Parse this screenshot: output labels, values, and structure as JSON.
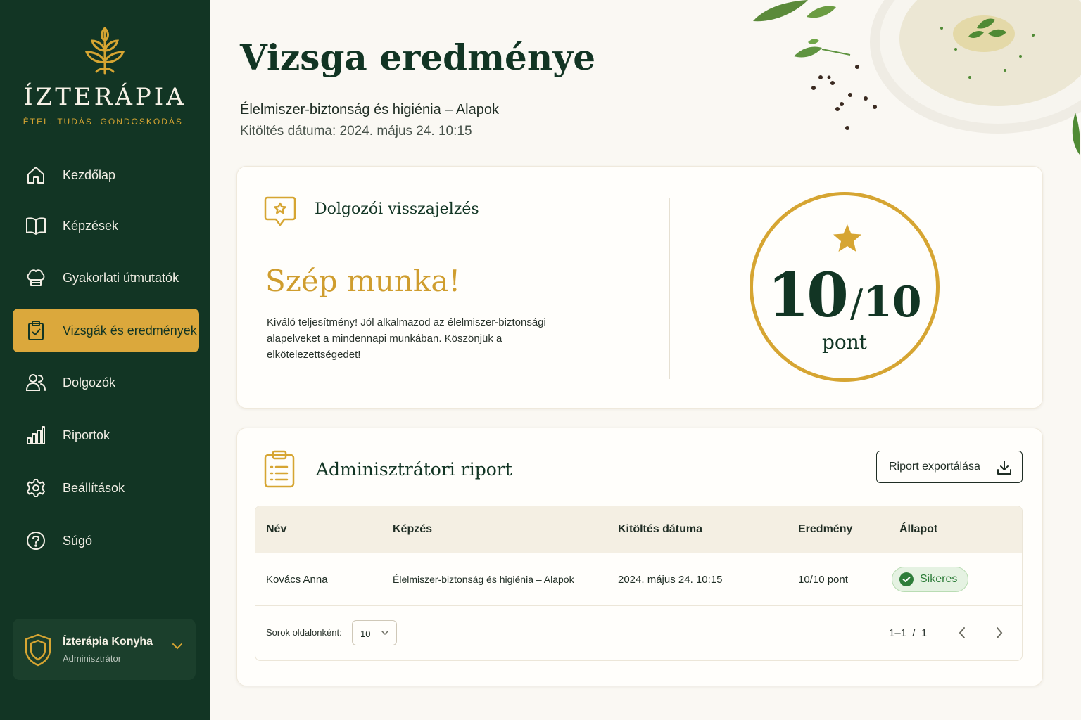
{
  "brand": {
    "name": "ÍZTERÁPIA",
    "tagline": "ÉTEL. TUDÁS. GONDOSKODÁS."
  },
  "nav": [
    {
      "label": "Kezdőlap",
      "icon": "home-icon"
    },
    {
      "label": "Képzések",
      "icon": "book-icon"
    },
    {
      "label": "Gyakorlati útmutatók",
      "icon": "chef-hat-icon"
    },
    {
      "label": "Vizsgák és eredmények",
      "icon": "clipboard-check-icon",
      "active": true
    },
    {
      "label": "Dolgozók",
      "icon": "users-icon"
    },
    {
      "label": "Riportok",
      "icon": "bar-chart-icon"
    },
    {
      "label": "Beállítások",
      "icon": "gear-icon"
    },
    {
      "label": "Súgó",
      "icon": "help-icon"
    }
  ],
  "account": {
    "name": "Ízterápia Konyha",
    "role": "Adminisztrátor",
    "icon": "shield-icon"
  },
  "page": {
    "title": "Vizsga eredménye",
    "subtitle": "Élelmiszer-biztonság és higiénia – Alapok",
    "date_line": "Kitöltés dátuma: 2024. május 24. 10:15"
  },
  "feedback": {
    "title": "Dolgozói visszajelzés",
    "headline": "Szép munka!",
    "text": "Kiváló teljesítmény! Jól alkalmazod az élelmiszer-biztonsági alapelveket a mindennapi munkában. Köszönjük a elkötelezettségedet!"
  },
  "score": {
    "value": "10",
    "separator": "/",
    "total": "10",
    "unit": "pont"
  },
  "report": {
    "title": "Adminisztrátori riport",
    "export_label": "Riport exportálása",
    "columns": [
      "Név",
      "Képzés",
      "Kitöltés dátuma",
      "Eredmény",
      "Állapot"
    ],
    "rows": [
      {
        "name": "Kovács Anna",
        "course": "Élelmiszer-biztonság és higiénia – Alapok",
        "date": "2024. május 24. 10:15",
        "result": "10/10 pont",
        "status": "Sikeres"
      }
    ],
    "rows_per_page_label": "Sorok oldalonként:",
    "rows_per_page_value": "10",
    "pager_info": "1–1  /  1"
  },
  "colors": {
    "sidebar": "#123524",
    "accent": "#d6a532",
    "success": "#2e7d3a"
  }
}
